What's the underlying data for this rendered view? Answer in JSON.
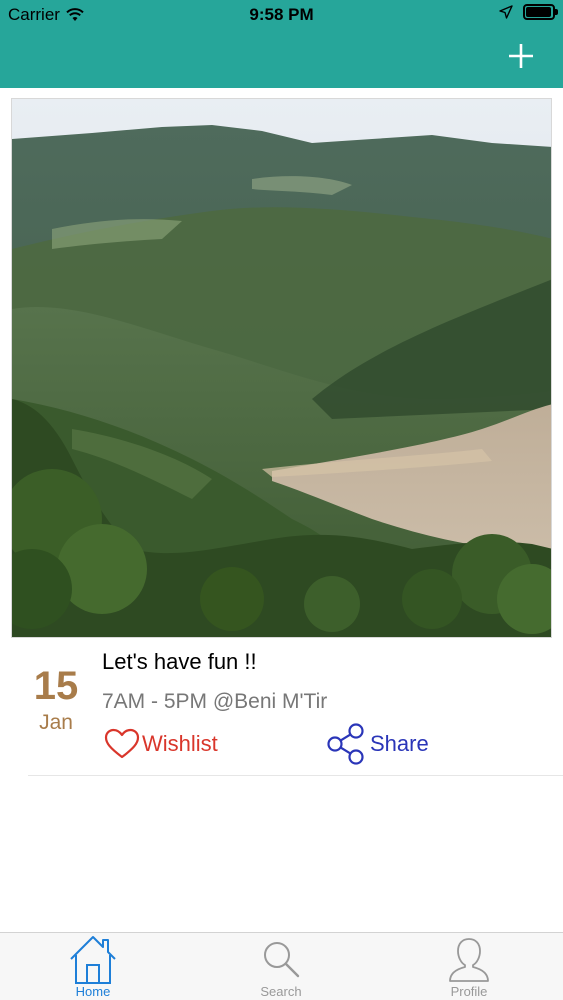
{
  "status_bar": {
    "carrier": "Carrier",
    "time": "9:58 PM"
  },
  "nav": {
    "add_icon": "plus-icon",
    "background_color": "#26a69a"
  },
  "post": {
    "image_description_icon": "landscape-photo",
    "day": "15",
    "month": "Jan",
    "title": "Let's have fun !!",
    "meta": "7AM - 5PM @Beni M'Tir",
    "wishlist_label": "Wishlist",
    "share_label": "Share",
    "date_color": "#a87c4a",
    "wishlist_color": "#d9362b",
    "share_color": "#2a35b8"
  },
  "tabs": [
    {
      "label": "Home",
      "icon": "home-icon",
      "active": true
    },
    {
      "label": "Search",
      "icon": "search-icon",
      "active": false
    },
    {
      "label": "Profile",
      "icon": "person-icon",
      "active": false
    }
  ],
  "colors": {
    "active_tab": "#1e7fd8",
    "inactive_tab": "#999999"
  }
}
